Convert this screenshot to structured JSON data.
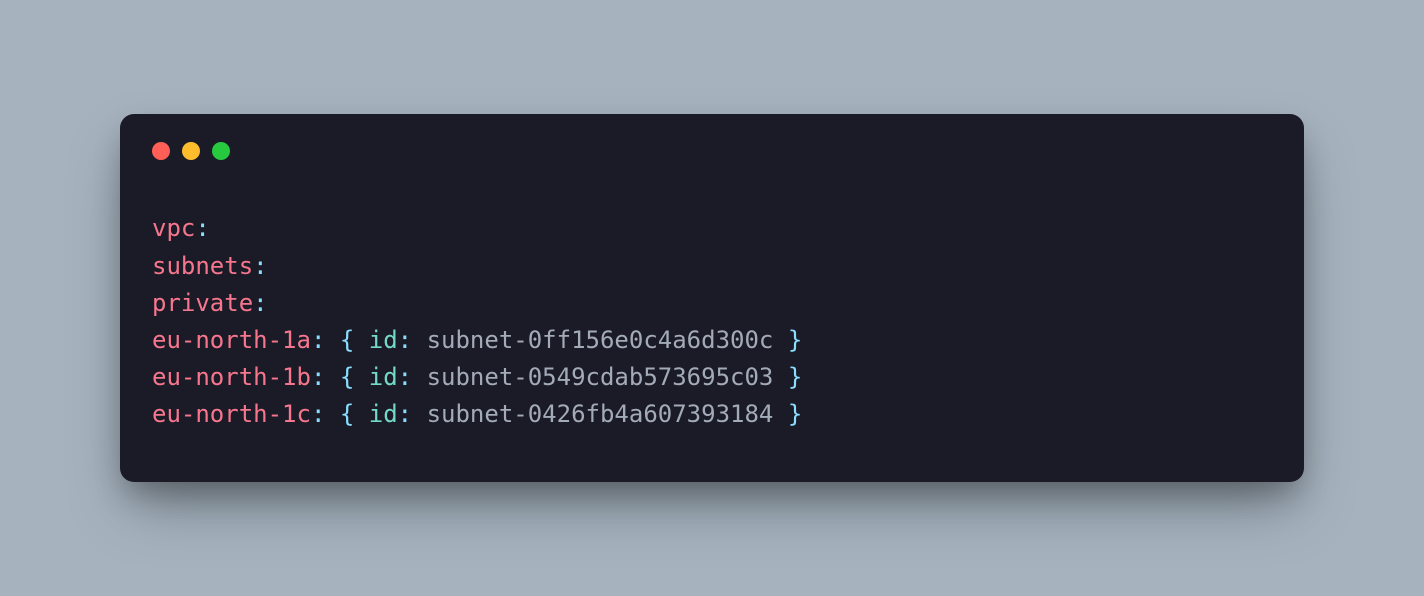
{
  "code": {
    "lines": [
      {
        "key": "vpc",
        "rest": ""
      },
      {
        "key": "subnets",
        "rest": ""
      },
      {
        "key": "private",
        "rest": ""
      },
      {
        "key": "eu-north-1a",
        "idKey": "id",
        "value": "subnet-0ff156e0c4a6d300c"
      },
      {
        "key": "eu-north-1b",
        "idKey": "id",
        "value": "subnet-0549cdab573695c03"
      },
      {
        "key": "eu-north-1c",
        "idKey": "id",
        "value": "subnet-0426fb4a607393184"
      }
    ],
    "punct": {
      "colon": ":",
      "openBrace": "{",
      "closeBrace": "}"
    }
  }
}
